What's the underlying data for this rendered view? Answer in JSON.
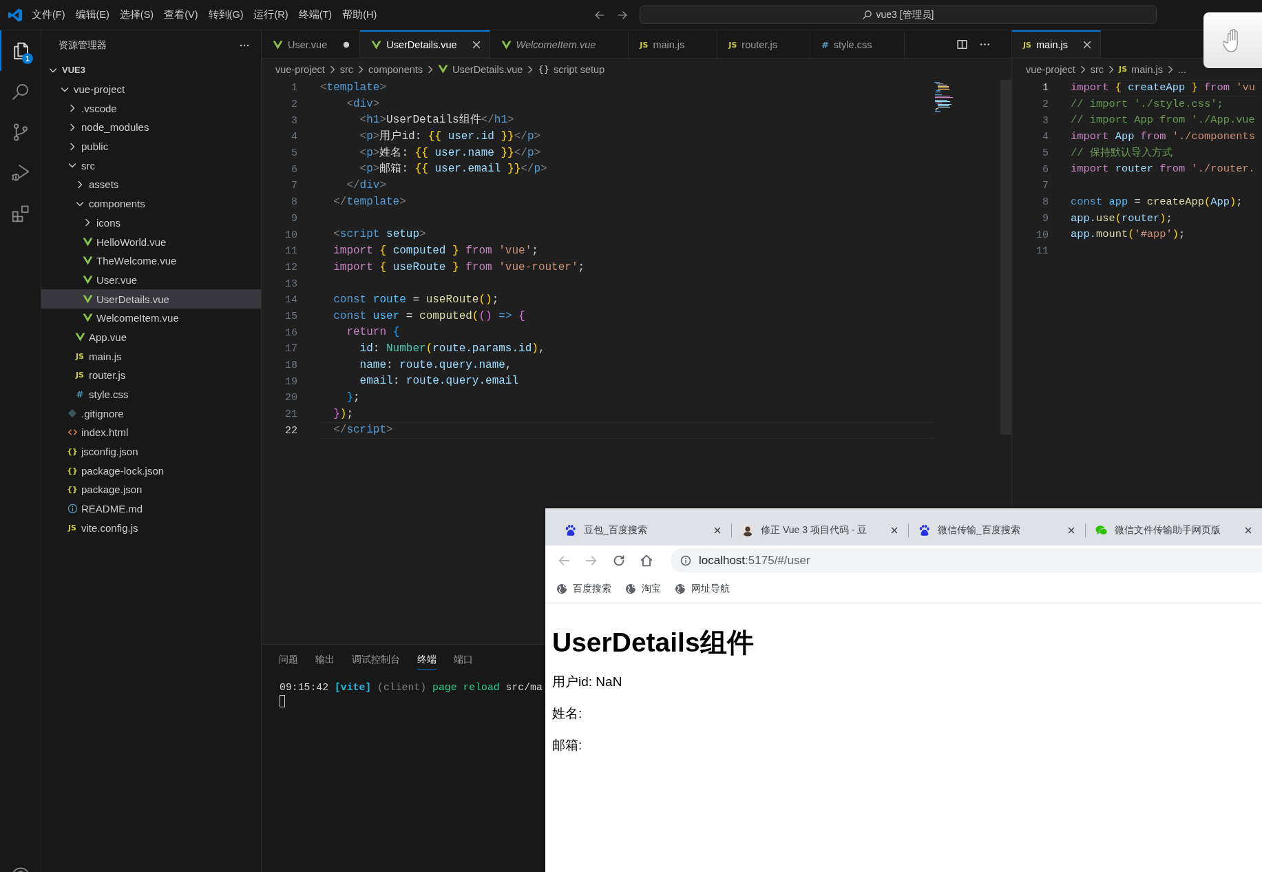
{
  "title_bar": {
    "menus": [
      "文件(F)",
      "编辑(E)",
      "选择(S)",
      "查看(V)",
      "转到(G)",
      "运行(R)",
      "终端(T)",
      "帮助(H)"
    ],
    "search": "vue3 [管理员]"
  },
  "activity_bar": {
    "items": [
      {
        "kind": "explorer",
        "selected": true,
        "badge": "1"
      },
      {
        "kind": "search",
        "selected": false
      },
      {
        "kind": "source-control",
        "selected": false
      },
      {
        "kind": "run-debug",
        "selected": false
      },
      {
        "kind": "extensions",
        "selected": false
      }
    ]
  },
  "sidebar": {
    "title": "资源管理器",
    "tree": [
      {
        "label": "VUE3",
        "kind": "root",
        "expanded": true,
        "selected": false,
        "children": [
          {
            "label": "vue-project",
            "kind": "folder",
            "expanded": true,
            "selected": false,
            "children": [
              {
                "label": ".vscode",
                "kind": "folder",
                "expanded": false,
                "selected": false
              },
              {
                "label": "node_modules",
                "kind": "folder",
                "expanded": false,
                "selected": false
              },
              {
                "label": "public",
                "kind": "folder",
                "expanded": false,
                "selected": false
              },
              {
                "label": "src",
                "kind": "folder",
                "expanded": true,
                "selected": false,
                "children": [
                  {
                    "label": "assets",
                    "kind": "folder",
                    "expanded": false,
                    "selected": false
                  },
                  {
                    "label": "components",
                    "kind": "folder",
                    "expanded": true,
                    "selected": false,
                    "children": [
                      {
                        "label": "icons",
                        "kind": "folder",
                        "expanded": false,
                        "selected": false
                      },
                      {
                        "label": "HelloWorld.vue",
                        "kind": "vue",
                        "selected": false
                      },
                      {
                        "label": "TheWelcome.vue",
                        "kind": "vue",
                        "selected": false
                      },
                      {
                        "label": "User.vue",
                        "kind": "vue",
                        "selected": false
                      },
                      {
                        "label": "UserDetails.vue",
                        "kind": "vue",
                        "selected": true
                      },
                      {
                        "label": "WelcomeItem.vue",
                        "kind": "vue",
                        "selected": false
                      }
                    ]
                  },
                  {
                    "label": "App.vue",
                    "kind": "vue",
                    "selected": false
                  },
                  {
                    "label": "main.js",
                    "kind": "js",
                    "icon": "JS",
                    "selected": false
                  },
                  {
                    "label": "router.js",
                    "kind": "js",
                    "icon": "JS",
                    "selected": false
                  },
                  {
                    "label": "style.css",
                    "kind": "css",
                    "icon": "#",
                    "selected": false
                  }
                ]
              },
              {
                "label": ".gitignore",
                "kind": "git",
                "selected": false
              },
              {
                "label": "index.html",
                "kind": "html",
                "selected": false
              },
              {
                "label": "jsconfig.json",
                "kind": "json",
                "icon": "{}",
                "selected": false
              },
              {
                "label": "package-lock.json",
                "kind": "json",
                "icon": "{}",
                "selected": false
              },
              {
                "label": "package.json",
                "kind": "json",
                "icon": "{}",
                "selected": false
              },
              {
                "label": "README.md",
                "kind": "info",
                "selected": false
              },
              {
                "label": "vite.config.js",
                "kind": "js",
                "icon": "JS",
                "selected": false
              }
            ]
          }
        ]
      }
    ]
  },
  "editor_groups": [
    {
      "tabs": [
        {
          "label": "User.vue",
          "kind": "vue",
          "selected": false,
          "modified": true,
          "preview": false
        },
        {
          "label": "UserDetails.vue",
          "kind": "vue",
          "selected": true,
          "modified": false,
          "preview": false
        },
        {
          "label": "WelcomeItem.vue",
          "kind": "vue",
          "selected": false,
          "modified": false,
          "preview": true
        },
        {
          "label": "main.js",
          "kind": "js",
          "icon": "JS",
          "selected": false,
          "modified": false,
          "preview": false
        },
        {
          "label": "router.js",
          "kind": "js",
          "icon": "JS",
          "selected": false,
          "modified": false,
          "preview": false
        },
        {
          "label": "style.css",
          "kind": "css",
          "icon": "#",
          "selected": false,
          "modified": false,
          "preview": false
        }
      ],
      "breadcrumb": [
        {
          "label": "vue-project"
        },
        {
          "label": "src"
        },
        {
          "label": "components"
        },
        {
          "label": "UserDetails.vue",
          "kind": "vue"
        },
        {
          "label": "script setup",
          "kind": "symbol",
          "icon": "{}"
        }
      ],
      "lines": [
        {
          "n": "1",
          "current": false,
          "tokens": [
            {
              "text": "<",
              "kind": "punct"
            },
            {
              "text": "template",
              "kind": "tag"
            },
            {
              "text": ">",
              "kind": "punct"
            }
          ]
        },
        {
          "n": "2",
          "current": false,
          "tokens": [
            {
              "text": "    <",
              "kind": "punct"
            },
            {
              "text": "div",
              "kind": "tag"
            },
            {
              "text": ">",
              "kind": "punct"
            }
          ]
        },
        {
          "n": "3",
          "current": false,
          "tokens": [
            {
              "text": "      <",
              "kind": "punct"
            },
            {
              "text": "h1",
              "kind": "tag"
            },
            {
              "text": ">",
              "kind": "punct"
            },
            {
              "text": "UserDetails组件",
              "kind": "text"
            },
            {
              "text": "</",
              "kind": "punct"
            },
            {
              "text": "h1",
              "kind": "tag"
            },
            {
              "text": ">",
              "kind": "punct"
            }
          ]
        },
        {
          "n": "4",
          "current": false,
          "tokens": [
            {
              "text": "      <",
              "kind": "punct"
            },
            {
              "text": "p",
              "kind": "tag"
            },
            {
              "text": ">",
              "kind": "punct"
            },
            {
              "text": "用户id: ",
              "kind": "text"
            },
            {
              "text": "{{",
              "kind": "b1"
            },
            {
              "text": " user.id ",
              "kind": "var"
            },
            {
              "text": "}}",
              "kind": "b1"
            },
            {
              "text": "</",
              "kind": "punct"
            },
            {
              "text": "p",
              "kind": "tag"
            },
            {
              "text": ">",
              "kind": "punct"
            }
          ]
        },
        {
          "n": "5",
          "current": false,
          "tokens": [
            {
              "text": "      <",
              "kind": "punct"
            },
            {
              "text": "p",
              "kind": "tag"
            },
            {
              "text": ">",
              "kind": "punct"
            },
            {
              "text": "姓名: ",
              "kind": "text"
            },
            {
              "text": "{{",
              "kind": "b1"
            },
            {
              "text": " user.name ",
              "kind": "var"
            },
            {
              "text": "}}",
              "kind": "b1"
            },
            {
              "text": "</",
              "kind": "punct"
            },
            {
              "text": "p",
              "kind": "tag"
            },
            {
              "text": ">",
              "kind": "punct"
            }
          ]
        },
        {
          "n": "6",
          "current": false,
          "tokens": [
            {
              "text": "      <",
              "kind": "punct"
            },
            {
              "text": "p",
              "kind": "tag"
            },
            {
              "text": ">",
              "kind": "punct"
            },
            {
              "text": "邮箱: ",
              "kind": "text"
            },
            {
              "text": "{{",
              "kind": "b1"
            },
            {
              "text": " user.email ",
              "kind": "var"
            },
            {
              "text": "}}",
              "kind": "b1"
            },
            {
              "text": "</",
              "kind": "punct"
            },
            {
              "text": "p",
              "kind": "tag"
            },
            {
              "text": ">",
              "kind": "punct"
            }
          ]
        },
        {
          "n": "7",
          "current": false,
          "tokens": [
            {
              "text": "    </",
              "kind": "punct"
            },
            {
              "text": "div",
              "kind": "tag"
            },
            {
              "text": ">",
              "kind": "punct"
            }
          ]
        },
        {
          "n": "8",
          "current": false,
          "tokens": [
            {
              "text": "  </",
              "kind": "punct"
            },
            {
              "text": "template",
              "kind": "tag"
            },
            {
              "text": ">",
              "kind": "punct"
            }
          ]
        },
        {
          "n": "9",
          "current": false
        },
        {
          "n": "10",
          "current": false,
          "tokens": [
            {
              "text": "  <",
              "kind": "punct"
            },
            {
              "text": "script",
              "kind": "tag"
            },
            {
              "text": " setup",
              "kind": "var"
            },
            {
              "text": ">",
              "kind": "punct"
            }
          ]
        },
        {
          "n": "11",
          "current": false,
          "tokens": [
            {
              "text": "  import ",
              "kind": "kw"
            },
            {
              "text": "{",
              "kind": "b1"
            },
            {
              "text": " computed ",
              "kind": "var"
            },
            {
              "text": "}",
              "kind": "b1"
            },
            {
              "text": " from ",
              "kind": "kw"
            },
            {
              "text": "'vue'",
              "kind": "str"
            },
            {
              "text": ";",
              "kind": "plain"
            }
          ]
        },
        {
          "n": "12",
          "current": false,
          "tokens": [
            {
              "text": "  import ",
              "kind": "kw"
            },
            {
              "text": "{",
              "kind": "b1"
            },
            {
              "text": " useRoute ",
              "kind": "var"
            },
            {
              "text": "}",
              "kind": "b1"
            },
            {
              "text": " from ",
              "kind": "kw"
            },
            {
              "text": "'vue-router'",
              "kind": "str"
            },
            {
              "text": ";",
              "kind": "plain"
            }
          ]
        },
        {
          "n": "13",
          "current": false
        },
        {
          "n": "14",
          "current": false,
          "tokens": [
            {
              "text": "  const",
              "kind": "decl"
            },
            {
              "text": " route",
              "kind": "const"
            },
            {
              "text": " = ",
              "kind": "plain"
            },
            {
              "text": "useRoute",
              "kind": "fn"
            },
            {
              "text": "()",
              "kind": "b1"
            },
            {
              "text": ";",
              "kind": "plain"
            }
          ]
        },
        {
          "n": "15",
          "current": false,
          "tokens": [
            {
              "text": "  const",
              "kind": "decl"
            },
            {
              "text": " user",
              "kind": "const"
            },
            {
              "text": " = ",
              "kind": "plain"
            },
            {
              "text": "computed",
              "kind": "fn"
            },
            {
              "text": "(",
              "kind": "b1"
            },
            {
              "text": "()",
              "kind": "b2"
            },
            {
              "text": " => ",
              "kind": "decl"
            },
            {
              "text": "{",
              "kind": "b2"
            }
          ]
        },
        {
          "n": "16",
          "current": false,
          "tokens": [
            {
              "text": "    return ",
              "kind": "kw"
            },
            {
              "text": "{",
              "kind": "b3"
            }
          ]
        },
        {
          "n": "17",
          "current": false,
          "tokens": [
            {
              "text": "      id",
              "kind": "var"
            },
            {
              "text": ": ",
              "kind": "plain"
            },
            {
              "text": "Number",
              "kind": "type"
            },
            {
              "text": "(",
              "kind": "b1"
            },
            {
              "text": "route.params.id",
              "kind": "var"
            },
            {
              "text": ")",
              "kind": "b1"
            },
            {
              "text": ",",
              "kind": "plain"
            }
          ]
        },
        {
          "n": "18",
          "current": false,
          "tokens": [
            {
              "text": "      name",
              "kind": "var"
            },
            {
              "text": ": ",
              "kind": "plain"
            },
            {
              "text": "route.query.name",
              "kind": "var"
            },
            {
              "text": ",",
              "kind": "plain"
            }
          ]
        },
        {
          "n": "19",
          "current": false,
          "tokens": [
            {
              "text": "      email",
              "kind": "var"
            },
            {
              "text": ": ",
              "kind": "plain"
            },
            {
              "text": "route.query.email",
              "kind": "var"
            }
          ]
        },
        {
          "n": "20",
          "current": false,
          "tokens": [
            {
              "text": "    }",
              "kind": "b3"
            },
            {
              "text": ";",
              "kind": "plain"
            }
          ]
        },
        {
          "n": "21",
          "current": false,
          "tokens": [
            {
              "text": "  }",
              "kind": "b2"
            },
            {
              "text": ")",
              "kind": "b1"
            },
            {
              "text": ";",
              "kind": "plain"
            }
          ]
        },
        {
          "n": "22",
          "current": true,
          "tokens": [
            {
              "text": "  </",
              "kind": "punct"
            },
            {
              "text": "script",
              "kind": "tag"
            },
            {
              "text": ">",
              "kind": "punct"
            }
          ]
        }
      ]
    },
    {
      "tabs": [
        {
          "label": "main.js",
          "kind": "js",
          "icon": "JS",
          "selected": true,
          "modified": false,
          "preview": false
        }
      ],
      "breadcrumb": [
        {
          "label": "vue-project"
        },
        {
          "label": "src"
        },
        {
          "label": "main.js",
          "kind": "js",
          "icon": "JS"
        },
        {
          "label": "..."
        }
      ],
      "lines": [
        {
          "n": "1",
          "current": true,
          "tokens": [
            {
              "text": "import ",
              "kind": "kw"
            },
            {
              "text": "{",
              "kind": "b1"
            },
            {
              "text": " createApp ",
              "kind": "var"
            },
            {
              "text": "}",
              "kind": "b1"
            },
            {
              "text": " from ",
              "kind": "kw"
            },
            {
              "text": "'vu",
              "kind": "str"
            }
          ]
        },
        {
          "n": "2",
          "current": false,
          "tokens": [
            {
              "text": "// import './style.css';",
              "kind": "com"
            }
          ]
        },
        {
          "n": "3",
          "current": false,
          "tokens": [
            {
              "text": "// import App from './App.vue",
              "kind": "com"
            }
          ]
        },
        {
          "n": "4",
          "current": false,
          "tokens": [
            {
              "text": "import",
              "kind": "kw"
            },
            {
              "text": " App ",
              "kind": "var"
            },
            {
              "text": "from ",
              "kind": "kw"
            },
            {
              "text": "'./components",
              "kind": "str"
            }
          ]
        },
        {
          "n": "5",
          "current": false,
          "tokens": [
            {
              "text": "// 保持默认导入方式",
              "kind": "com"
            }
          ]
        },
        {
          "n": "6",
          "current": false,
          "tokens": [
            {
              "text": "import",
              "kind": "kw"
            },
            {
              "text": " router ",
              "kind": "var"
            },
            {
              "text": "from ",
              "kind": "kw"
            },
            {
              "text": "'./router.",
              "kind": "str"
            }
          ]
        },
        {
          "n": "7",
          "current": false
        },
        {
          "n": "8",
          "current": false,
          "tokens": [
            {
              "text": "const",
              "kind": "decl"
            },
            {
              "text": " app",
              "kind": "const"
            },
            {
              "text": " = ",
              "kind": "plain"
            },
            {
              "text": "createApp",
              "kind": "fn"
            },
            {
              "text": "(",
              "kind": "b1"
            },
            {
              "text": "App",
              "kind": "var"
            },
            {
              "text": ")",
              "kind": "b1"
            },
            {
              "text": ";",
              "kind": "plain"
            }
          ]
        },
        {
          "n": "9",
          "current": false,
          "tokens": [
            {
              "text": "app.",
              "kind": "var"
            },
            {
              "text": "use",
              "kind": "fn"
            },
            {
              "text": "(",
              "kind": "b1"
            },
            {
              "text": "router",
              "kind": "var"
            },
            {
              "text": ")",
              "kind": "b1"
            },
            {
              "text": ";",
              "kind": "plain"
            }
          ]
        },
        {
          "n": "10",
          "current": false,
          "tokens": [
            {
              "text": "app.",
              "kind": "var"
            },
            {
              "text": "mount",
              "kind": "fn"
            },
            {
              "text": "(",
              "kind": "b1"
            },
            {
              "text": "'#app'",
              "kind": "str"
            },
            {
              "text": ")",
              "kind": "b1"
            },
            {
              "text": ";",
              "kind": "plain"
            }
          ]
        },
        {
          "n": "11",
          "current": false
        }
      ]
    }
  ],
  "panel": {
    "tabs": [
      {
        "label": "问题",
        "selected": false
      },
      {
        "label": "输出",
        "selected": false
      },
      {
        "label": "调试控制台",
        "selected": false
      },
      {
        "label": "终端",
        "selected": true
      },
      {
        "label": "端口",
        "selected": false
      }
    ],
    "terminal": [
      {
        "text": "09:15:42 ",
        "kind": "plain"
      },
      {
        "text": "[vite]",
        "kind": "vite"
      },
      {
        "text": " (client) ",
        "kind": "dim"
      },
      {
        "text": "page reload",
        "kind": "green"
      },
      {
        "text": " src/ma",
        "kind": "plain"
      }
    ]
  },
  "browser": {
    "tabs": [
      {
        "title": "豆包_百度搜索",
        "kind": "paw"
      },
      {
        "title": "修正 Vue 3 项目代码 - 豆",
        "kind": "avatar"
      },
      {
        "title": "微信传输_百度搜索",
        "kind": "paw"
      },
      {
        "title": "微信文件传输助手网页版",
        "kind": "chat"
      }
    ],
    "address": {
      "host": "localhost",
      "path": ":5175/#/user"
    },
    "bookmarks": [
      "百度搜索",
      "淘宝",
      "网址导航"
    ],
    "page": {
      "heading": "UserDetails组件",
      "paragraphs": [
        "用户id: NaN",
        "姓名:",
        "邮箱:"
      ]
    }
  }
}
